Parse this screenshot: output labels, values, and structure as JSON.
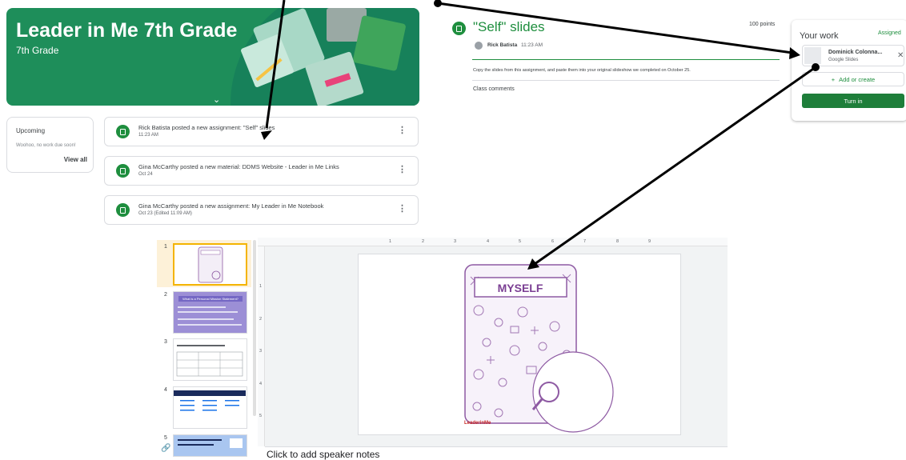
{
  "banner": {
    "title": "Leader in Me 7th Grade",
    "subtitle": "7th Grade",
    "colors": {
      "bg": "#1e8e5a"
    }
  },
  "upcoming": {
    "heading": "Upcoming",
    "message": "Woohoo, no work due soon!",
    "view_all": "View all"
  },
  "stream": [
    {
      "text": "Rick Batista posted a new assignment: \"Self\" slides",
      "date": "11:23 AM",
      "icon": "assignment-icon"
    },
    {
      "text": "Gina McCarthy posted a new material: DDMS Website - Leader in Me Links",
      "date": "Oct 24",
      "icon": "material-icon"
    },
    {
      "text": "Gina McCarthy posted a new assignment: My Leader in Me Notebook",
      "date": "Oct 23 (Edited 11:09 AM)",
      "icon": "assignment-icon"
    }
  ],
  "assignment": {
    "title": "\"Self\" slides",
    "points": "100 points",
    "author": "Rick Batista",
    "time": "11:23 AM",
    "instructions": "Copy the slides from this assignment, and paste them into your original slideshow we completed on October 25.",
    "class_comments": "Class comments",
    "accent": "#1e8e3e"
  },
  "your_work": {
    "heading": "Your work",
    "status": "Assigned",
    "file_name": "Dominick Colonna...",
    "file_type": "Google Slides",
    "add_create": "Add or create",
    "turn_in": "Turn in"
  },
  "slides_editor": {
    "thumbnails": [
      "1",
      "2",
      "3",
      "4",
      "5"
    ],
    "ruler_top": [
      "1",
      "2",
      "3",
      "4",
      "5",
      "6",
      "7",
      "8",
      "9"
    ],
    "ruler_left": [
      "1",
      "2",
      "3",
      "4",
      "5"
    ],
    "slide_title": "MYSELF",
    "thumb2_title": "What is a Personal Mission Statement?",
    "logo": "LeaderinMe",
    "notes_placeholder": "Click to add speaker notes"
  }
}
